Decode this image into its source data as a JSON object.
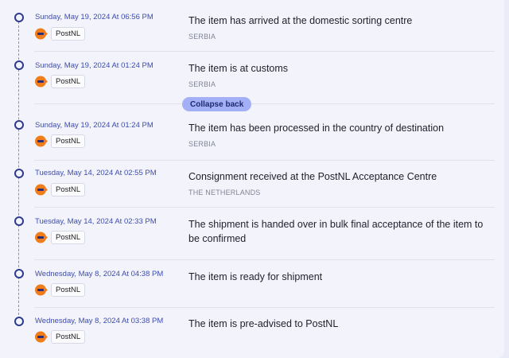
{
  "collapse_label": "Collapse back",
  "events": [
    {
      "date": "Sunday, May 19, 2024 At 06:56 PM",
      "carrier": "PostNL",
      "title": "The item has arrived at the domestic sorting centre",
      "country": "SERBIA"
    },
    {
      "date": "Sunday, May 19, 2024 At 01:24 PM",
      "carrier": "PostNL",
      "title": "The item is at customs",
      "country": "SERBIA"
    },
    {
      "date": "Sunday, May 19, 2024 At 01:24 PM",
      "carrier": "PostNL",
      "title": "The item has been processed in the country of destination",
      "country": "SERBIA"
    },
    {
      "date": "Tuesday, May 14, 2024 At 02:55 PM",
      "carrier": "PostNL",
      "title": "Consignment received at the PostNL Acceptance Centre",
      "country": "THE NETHERLANDS"
    },
    {
      "date": "Tuesday, May 14, 2024 At 02:33 PM",
      "carrier": "PostNL",
      "title": "The shipment is handed over in bulk final acceptance of the item to be confirmed",
      "country": ""
    },
    {
      "date": "Wednesday, May 8, 2024 At 04:38 PM",
      "carrier": "PostNL",
      "title": "The item is ready for shipment",
      "country": ""
    },
    {
      "date": "Wednesday, May 8, 2024 At 03:38 PM",
      "carrier": "PostNL",
      "title": "The item is pre-advised to PostNL",
      "country": ""
    }
  ],
  "colors": {
    "accent": "#3b4bb0",
    "dot": "#2e3a8c",
    "collapse_bg": "#a3b0f5",
    "postnl_orange": "#f07d1a"
  },
  "icons": {
    "carrier_logo": "postnl-logo-icon"
  }
}
